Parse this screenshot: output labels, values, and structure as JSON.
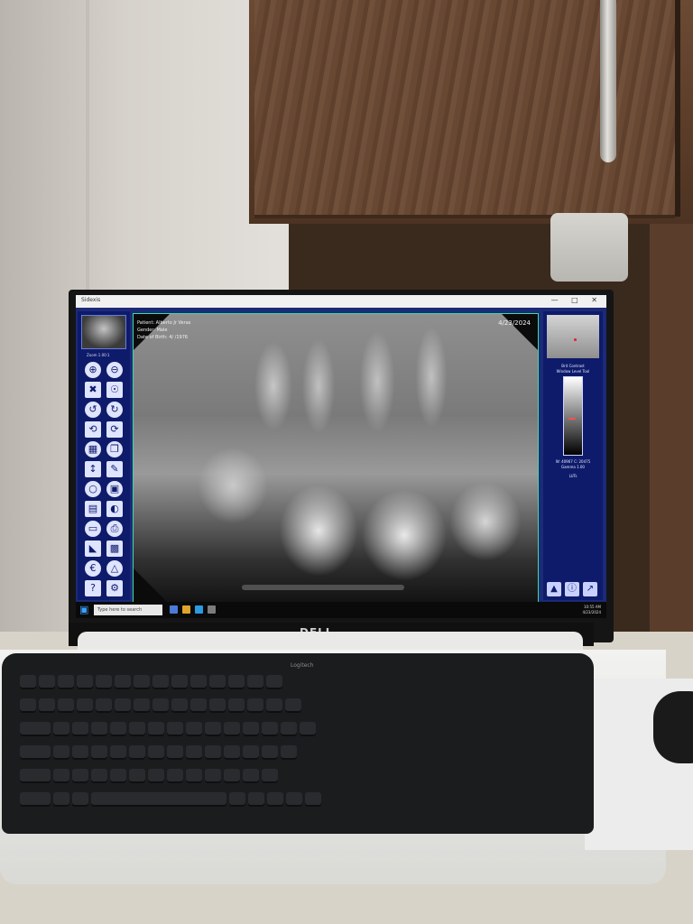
{
  "app": {
    "title_text": "Sidexis",
    "window_controls": "— □ ✕"
  },
  "toolbar": {
    "zoom_label": "Zoom 1.00:1",
    "tools": [
      {
        "name": "zoom-in-icon",
        "glyph": "⊕"
      },
      {
        "name": "zoom-out-icon",
        "glyph": "⊖"
      },
      {
        "name": "fit-icon",
        "glyph": "✖"
      },
      {
        "name": "zoom-region-icon",
        "glyph": "☉"
      },
      {
        "name": "rotate-left-icon",
        "glyph": "↺"
      },
      {
        "name": "rotate-right-icon",
        "glyph": "↻"
      },
      {
        "name": "undo-icon",
        "glyph": "⟲"
      },
      {
        "name": "redo-icon",
        "glyph": "⟳"
      },
      {
        "name": "grid-icon",
        "glyph": "▦"
      },
      {
        "name": "copy-icon",
        "glyph": "❐"
      },
      {
        "name": "ruler-icon",
        "glyph": "↕"
      },
      {
        "name": "pencil-icon",
        "glyph": "✎"
      },
      {
        "name": "magnify-icon",
        "glyph": "○"
      },
      {
        "name": "crop-icon",
        "glyph": "▣"
      },
      {
        "name": "histogram-icon",
        "glyph": "▤"
      },
      {
        "name": "contrast-icon",
        "glyph": "◐"
      },
      {
        "name": "image-icon",
        "glyph": "▭"
      },
      {
        "name": "print-icon",
        "glyph": "⎙"
      },
      {
        "name": "triangle-filter-icon",
        "glyph": "◣"
      },
      {
        "name": "color-map-icon",
        "glyph": "▩"
      },
      {
        "name": "euro-icon",
        "glyph": "€"
      },
      {
        "name": "angle-icon",
        "glyph": "△"
      },
      {
        "name": "help-icon",
        "glyph": "?"
      },
      {
        "name": "settings-icon",
        "glyph": "⚙"
      }
    ]
  },
  "patient": {
    "name_line": "Patient: Alberto Jr Veras",
    "gender_line": "Gender: Male",
    "dob_line": "Date of Birth: 4/  /1976",
    "exam_date": "4/23/2024"
  },
  "right_panel": {
    "section_title": "Brit Contrast",
    "subtitle": "Window Level Tool",
    "values_line": "W: 40967  C: 20475",
    "gamma_line": "Gamma 1.00",
    "luts_label": "LUTs"
  },
  "taskbar": {
    "search_placeholder": "Type here to search",
    "time": "10:55 AM",
    "date": "4/23/2024"
  },
  "keyboard": {
    "brand": "Logitech"
  },
  "monitor": {
    "brand": "DELL"
  }
}
